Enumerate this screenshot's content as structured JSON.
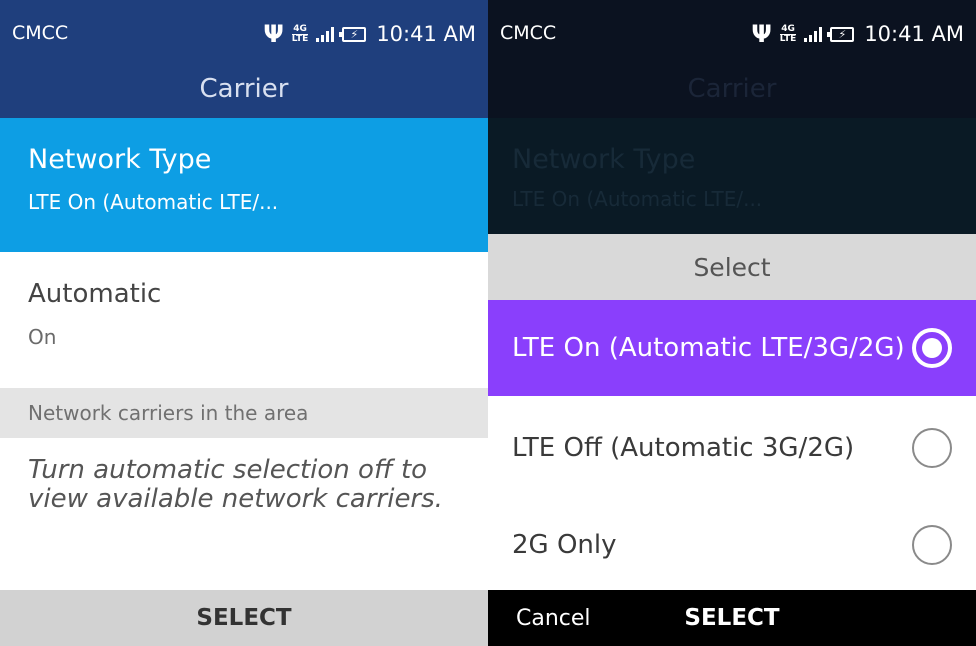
{
  "left_screen": {
    "status": {
      "carrier": "CMCC",
      "network": "4G",
      "network_sub": "LTE",
      "time": "10:41 AM"
    },
    "header_title": "Carrier",
    "network_type": {
      "title": "Network Type",
      "value": "LTE On (Automatic LTE/..."
    },
    "automatic": {
      "title": "Automatic",
      "value": "On"
    },
    "section_header": "Network carriers in the area",
    "info_text": "Turn automatic selection off to view available network carriers.",
    "softkeys": {
      "center": "SELECT"
    }
  },
  "right_screen": {
    "status": {
      "carrier": "CMCC",
      "network": "4G",
      "network_sub": "LTE",
      "time": "10:41 AM"
    },
    "header_title": "Carrier",
    "network_type": {
      "title": "Network Type",
      "value": "LTE On (Automatic LTE/..."
    },
    "dialog": {
      "title": "Select",
      "options": [
        {
          "label": "LTE On (Automatic LTE/3G/2G)",
          "selected": true
        },
        {
          "label": "LTE Off (Automatic 3G/2G)",
          "selected": false
        },
        {
          "label": "2G Only",
          "selected": false
        }
      ]
    },
    "softkeys": {
      "left": "Cancel",
      "center": "SELECT"
    }
  },
  "colors": {
    "status_bar_left": "#1f3f7d",
    "focus_highlight": "#0d9ee4",
    "selected_option": "#8a3ffc",
    "section_header_bg": "#e4e4e4",
    "softkey_bar_left": "#d2d2d2",
    "softkey_bar_right": "#000000"
  },
  "icons": [
    "usb-icon",
    "lte-4g-icon",
    "signal-icon",
    "battery-charging-icon",
    "radio-selected-icon",
    "radio-unselected-icon"
  ]
}
